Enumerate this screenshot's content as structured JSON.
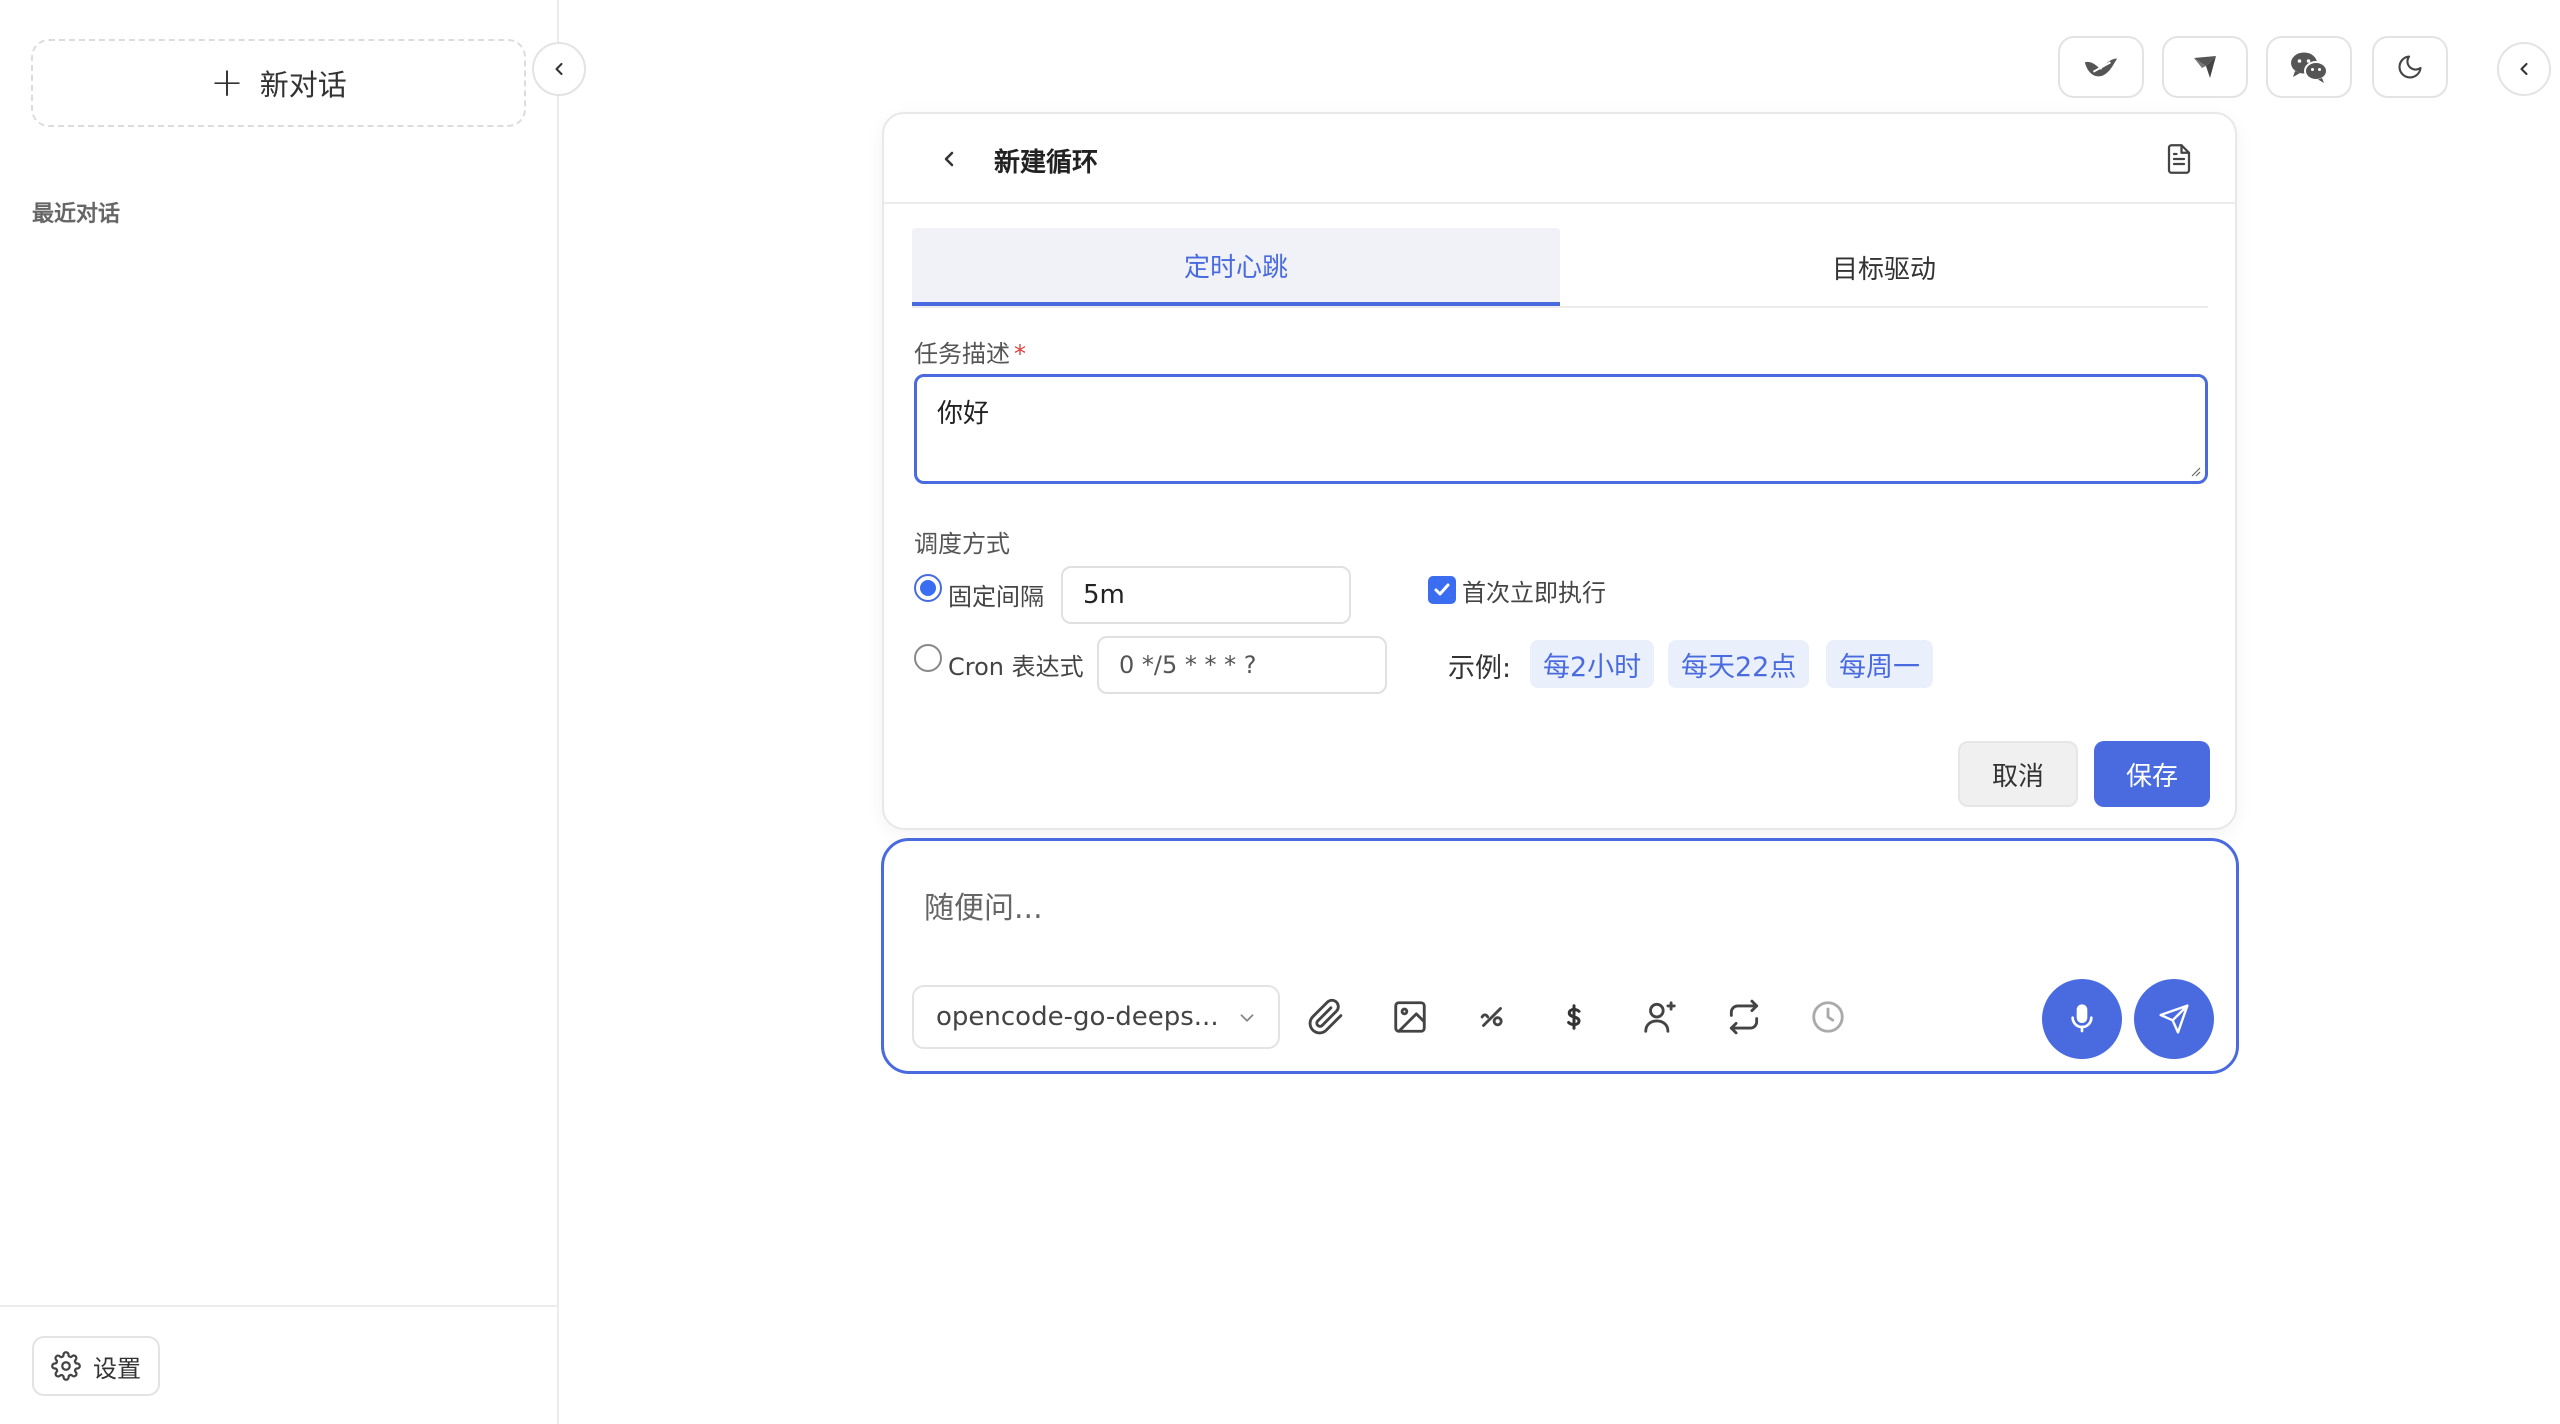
{
  "sidebar": {
    "new_chat_label": "新对话",
    "recent_label": "最近对话",
    "settings_label": "设置"
  },
  "panel": {
    "title": "新建循环",
    "tabs": [
      {
        "label": "定时心跳",
        "active": true
      },
      {
        "label": "目标驱动",
        "active": false
      }
    ],
    "task_label": "任务描述",
    "task_required_mark": "*",
    "task_value": "你好",
    "schedule_label": "调度方式",
    "fixed_interval": {
      "label": "固定间隔",
      "value": "5m",
      "checked": true
    },
    "run_immediately": {
      "label": "首次立即执行",
      "checked": true
    },
    "cron": {
      "label": "Cron 表达式",
      "placeholder": "0 */5 * * * ?",
      "checked": false
    },
    "examples_label": "示例:",
    "examples": [
      "每2小时",
      "每天22点",
      "每周一"
    ],
    "cancel_label": "取消",
    "save_label": "保存"
  },
  "composer": {
    "placeholder": "随便问...",
    "model": "opencode-go-deeps..."
  },
  "colors": {
    "accent": "#4a6be0",
    "chip_bg": "#eaf0fb",
    "border": "#e3e3e3"
  },
  "icons": {
    "top_buttons": [
      "dove-icon",
      "feishu-icon",
      "wechat-icon",
      "moon-icon"
    ],
    "composer_tools": [
      "paperclip-icon",
      "image-icon",
      "percent-slash-icon",
      "dollar-icon",
      "user-add-icon",
      "loop-icon",
      "clock-icon"
    ]
  }
}
